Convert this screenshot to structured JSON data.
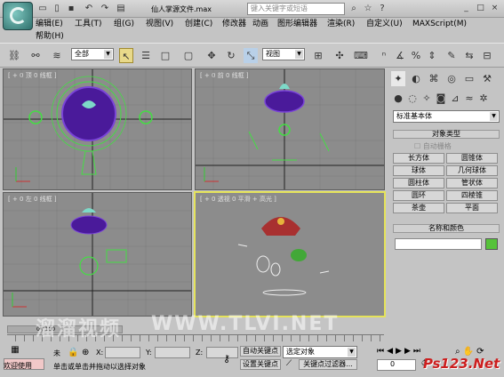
{
  "title": {
    "app_title": "仙人掌源文件.max",
    "search_placeholder": "键入关键字或短语"
  },
  "menu": {
    "items": [
      "编辑(E)",
      "工具(T)",
      "组(G)",
      "视图(V)",
      "创建(C)",
      "修改器",
      "动画",
      "图形编辑器",
      "渲染(R)",
      "自定义(U)",
      "MAXScript(M)",
      "帮助(H)"
    ]
  },
  "toolbar": {
    "filter_value": "全部",
    "coord_value": "视图"
  },
  "viewports": [
    {
      "label": "[ + 0 顶 0 线框 ]"
    },
    {
      "label": "[ + 0 前 0 线框 ]"
    },
    {
      "label": "[ + 0 左 0 线框 ]"
    },
    {
      "label": "[ + 0 透视 0 平滑 + 高光 ]"
    }
  ],
  "command_panel": {
    "category": "标准基本体",
    "object_type_title": "对象类型",
    "autogrid": "自动栅格",
    "buttons": [
      "长方体",
      "圆锥体",
      "球体",
      "几何球体",
      "圆柱体",
      "管状体",
      "圆环",
      "四棱锥",
      "茶壶",
      "平面"
    ],
    "name_color_title": "名称和颜色",
    "color": "#56c23a"
  },
  "status": {
    "frame_counter": "0 / 100",
    "welcome": "欢迎使用",
    "unselected": "未",
    "x_label": "X:",
    "y_label": "Y:",
    "z_label": "Z:",
    "auto_key": "自动关键点",
    "selected_obj": "选定对象",
    "set_key": "设置关键点",
    "key_filters": "关键点过滤器...",
    "prompt": "单击或单击并拖动以选择对象",
    "frame_field": "0"
  },
  "watermark": {
    "site": "WWW.TLVI.NET",
    "chinese": "溜溜视频",
    "ps_logo": "Ps123.Net"
  }
}
